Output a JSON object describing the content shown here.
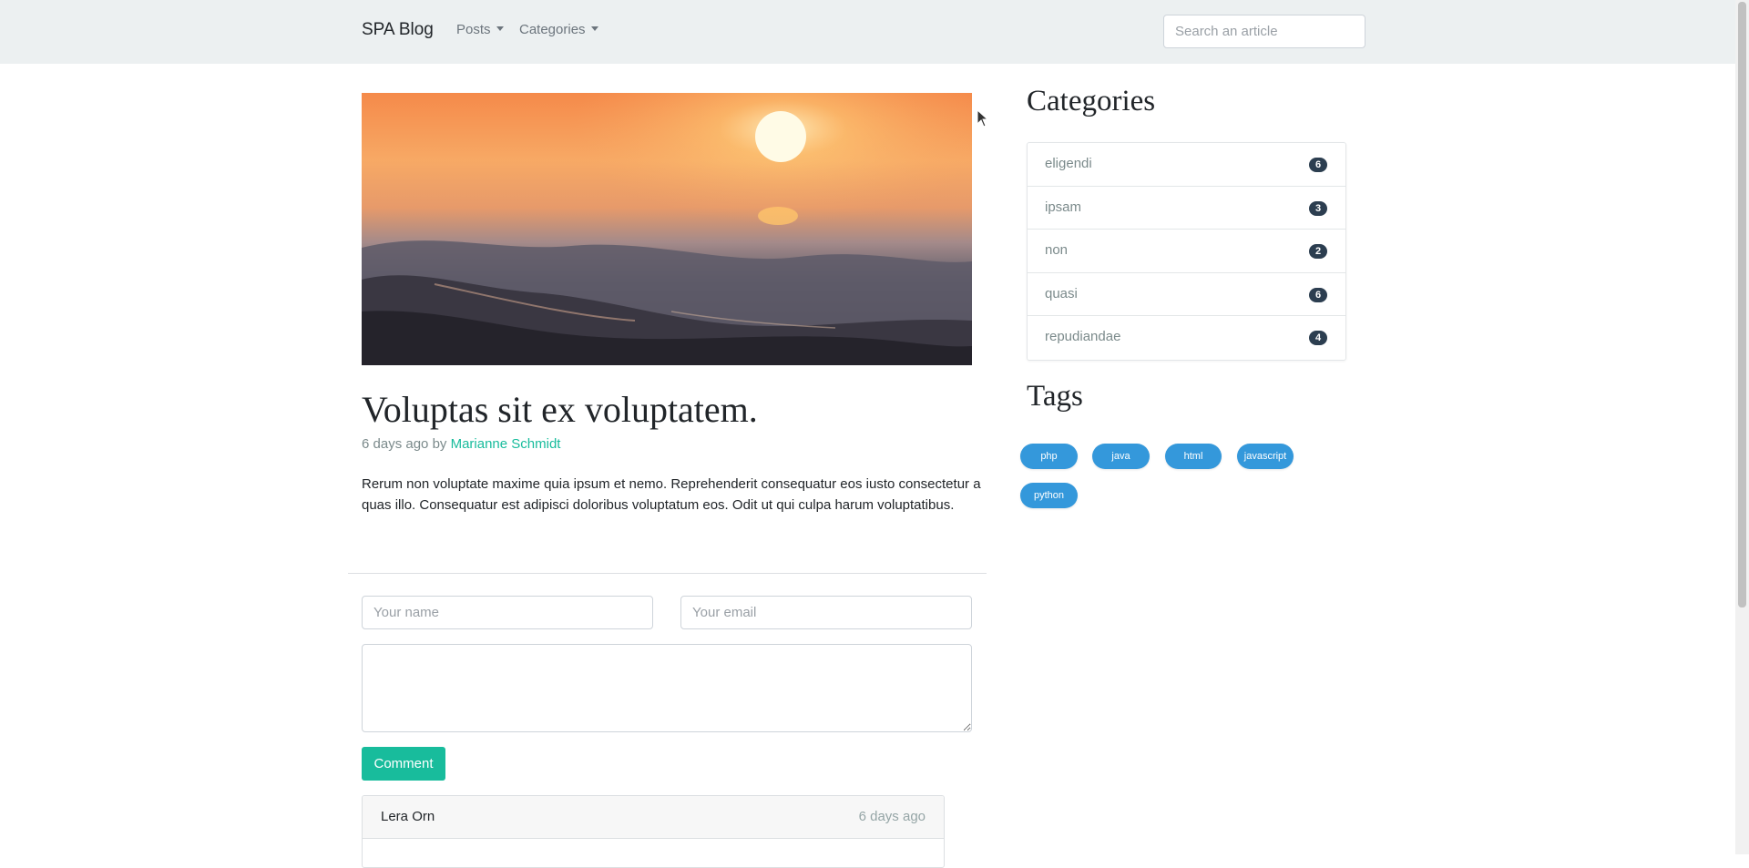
{
  "navbar": {
    "brand": "SPA Blog",
    "menu": [
      {
        "label": "Posts"
      },
      {
        "label": "Categories"
      }
    ],
    "search_placeholder": "Search an article"
  },
  "hero": {
    "image_icon": "sunset-ocean-waves-image"
  },
  "post": {
    "title": "Voluptas sit ex voluptatem.",
    "time": "6 days ago",
    "by": "by",
    "author": "Marianne Schmidt",
    "body": "Rerum non voluptate maxime quia ipsum et nemo. Reprehenderit consequatur eos iusto consectetur a quas illo. Consequatur est adipisci doloribus voluptatum eos. Odit ut qui culpa harum voluptatibus."
  },
  "comment_form": {
    "name_placeholder": "Your name",
    "email_placeholder": "Your email",
    "body_placeholder": "",
    "submit_label": "Comment"
  },
  "comments": [
    {
      "author": "Lera Orn",
      "time": "6 days ago"
    }
  ],
  "sidebar": {
    "categories_heading": "Categories",
    "categories": [
      {
        "name": "eligendi",
        "count": "6"
      },
      {
        "name": "ipsam",
        "count": "3"
      },
      {
        "name": "non",
        "count": "2"
      },
      {
        "name": "quasi",
        "count": "6"
      },
      {
        "name": "repudiandae",
        "count": "4"
      }
    ],
    "tags_heading": "Tags",
    "tags": [
      "php",
      "java",
      "html",
      "javascript",
      "python"
    ]
  },
  "colors": {
    "navbar_bg": "#ecf0f1",
    "accent_green": "#18bc9c",
    "tag_blue": "#3498db",
    "badge_dark": "#2c3e50"
  }
}
